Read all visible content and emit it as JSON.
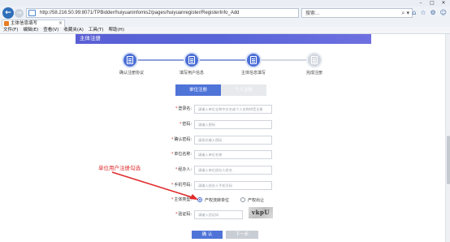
{
  "browser": {
    "url": "http://58.216.50.99:8071/TPBidder/huiyuaninfomis2/pages/huiyuanregister/RegisterInfo_Add",
    "search_text": "搜索...",
    "tab_title": "主体信息填写",
    "menu": [
      "文件(F)",
      "编辑(E)",
      "查看(V)",
      "收藏夹(A)",
      "工具(T)",
      "帮助(H)"
    ]
  },
  "page": {
    "banner_title": "主体注册",
    "steps": [
      {
        "label": "确认注册协议",
        "active": true
      },
      {
        "label": "填写用户信息",
        "active": true
      },
      {
        "label": "主体信息填写",
        "active": true
      },
      {
        "label": "完成注册",
        "active": false
      }
    ],
    "type_tabs": [
      {
        "label": "单位注册",
        "active": true
      },
      {
        "label": "个人注册",
        "active": false
      }
    ],
    "fields": [
      {
        "label": "登录名:",
        "required": true,
        "placeholder": "请输入单位全称中文名或个人名称拼音注册"
      },
      {
        "label": "密码:",
        "required": true,
        "placeholder": "请输入密码"
      },
      {
        "label": "确认密码:",
        "required": true,
        "placeholder": "请再次输入密码"
      },
      {
        "label": "单位名称:",
        "required": true,
        "placeholder": "请输入单位名称"
      },
      {
        "label": "经办人:",
        "required": true,
        "placeholder": "请输入单位经办人姓名"
      },
      {
        "label": "手机号码:",
        "required": true,
        "placeholder": "请输入经办人手机号码"
      }
    ],
    "subject_type": {
      "label": "主体类型:",
      "options": [
        {
          "label": "产权流转单位",
          "checked": true
        },
        {
          "label": "产权出让",
          "checked": false
        }
      ]
    },
    "captcha": {
      "label": "验证码:",
      "placeholder": "请输入验证码",
      "image_text": "vkpU"
    },
    "buttons": {
      "confirm": "确 认",
      "next": "下一步"
    },
    "annotation": "单位用户注册勾选"
  },
  "colors": {
    "accent": "#4f74d8",
    "annotation": "#e02b2b"
  }
}
